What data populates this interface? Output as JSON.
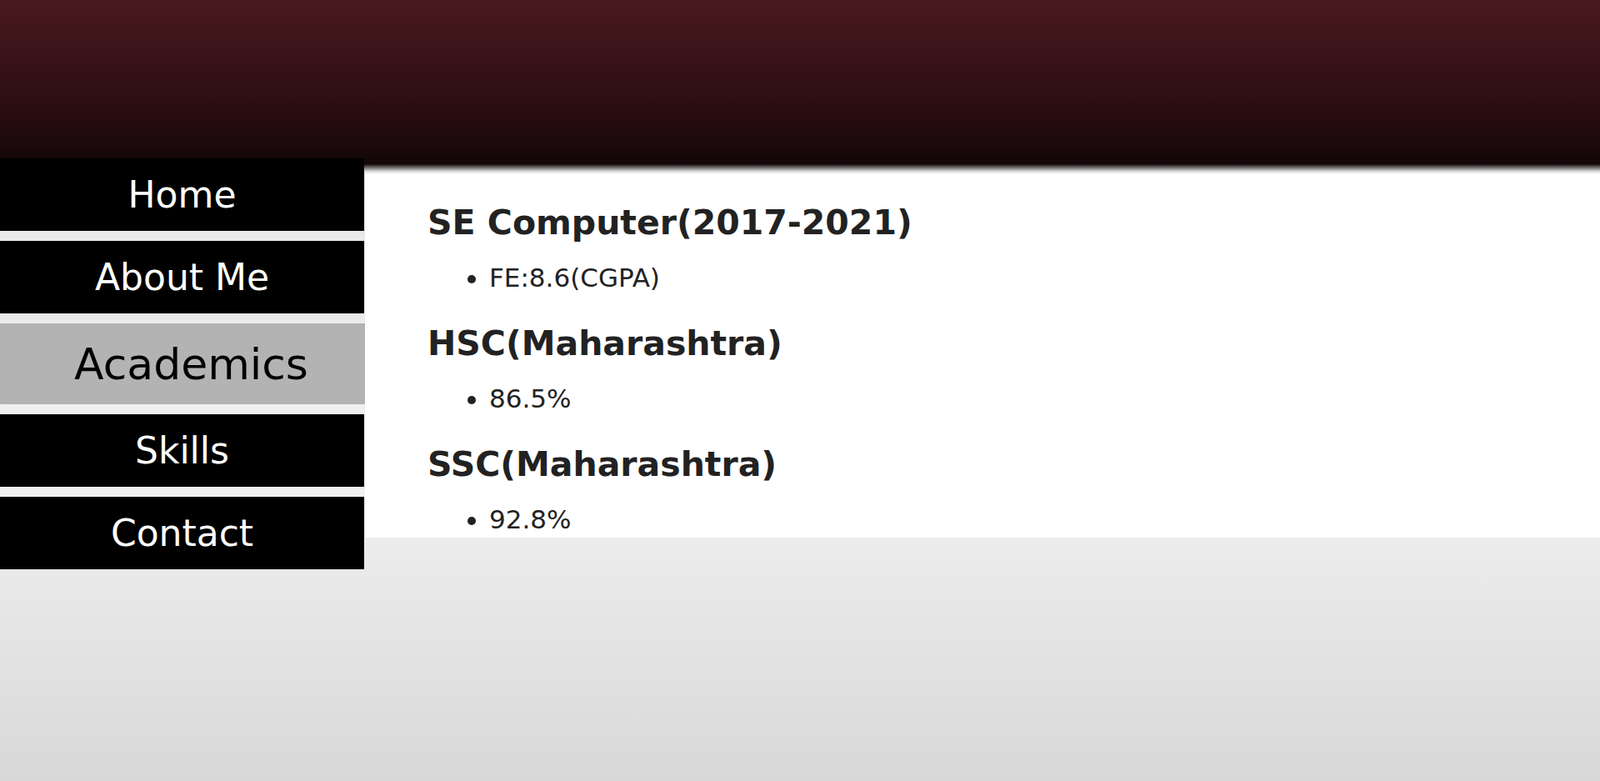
{
  "nav": {
    "items": [
      {
        "label": "Home",
        "selected": false
      },
      {
        "label": "About Me",
        "selected": false
      },
      {
        "label": "Academics",
        "selected": true
      },
      {
        "label": "Skills",
        "selected": false
      },
      {
        "label": "Contact",
        "selected": false
      }
    ]
  },
  "academics": [
    {
      "title": "SE Computer(2017-2021)",
      "items": [
        "FE:8.6(CGPA)"
      ]
    },
    {
      "title": "HSC(Maharashtra)",
      "items": [
        "86.5%"
      ]
    },
    {
      "title": "SSC(Maharashtra)",
      "items": [
        "92.8%"
      ]
    }
  ]
}
